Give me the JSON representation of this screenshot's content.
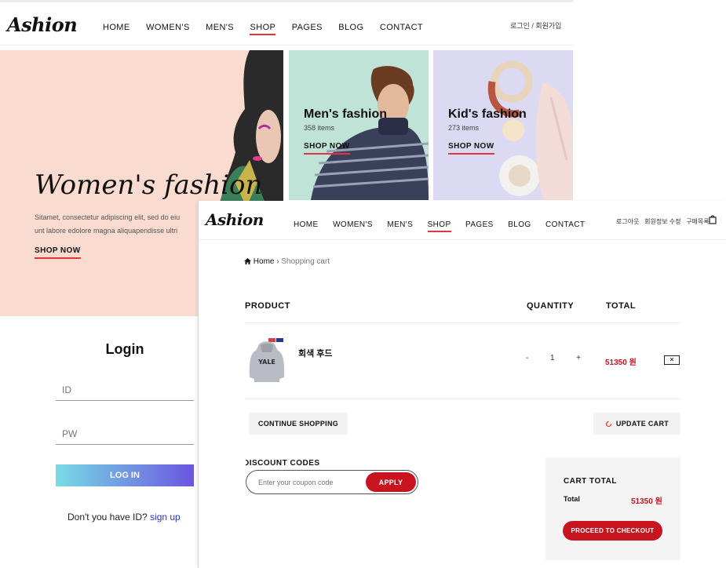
{
  "home": {
    "logo": "Ashion",
    "nav": [
      "HOME",
      "WOMEN'S",
      "MEN'S",
      "SHOP",
      "PAGES",
      "BLOG",
      "CONTACT"
    ],
    "active_nav": "SHOP",
    "auth_links": "로그인 / 회원가입",
    "hero": {
      "title": "Women's fashion",
      "text_line1": "Sitamet, consectetur adipiscing elit, sed do eiu",
      "text_line2": "unt labore edolore magna aliquapendisse ultri",
      "cta": "SHOP NOW"
    },
    "cards": [
      {
        "title": "Men's fashion",
        "count": "358 items",
        "cta": "SHOP NOW"
      },
      {
        "title": "Kid's fashion",
        "count": "273 items",
        "cta": "SHOP NOW"
      }
    ]
  },
  "login": {
    "title": "Login",
    "id_placeholder": "ID",
    "pw_placeholder": "PW",
    "button": "LOG IN",
    "signup_prompt": "Don't you have ID?",
    "signup_link": "sign up"
  },
  "cart_page": {
    "logo": "Ashion",
    "nav": [
      "HOME",
      "WOMEN'S",
      "MEN'S",
      "SHOP",
      "PAGES",
      "BLOG",
      "CONTACT"
    ],
    "active_nav": "SHOP",
    "user_links": [
      "로그아웃",
      "회원정보 수정",
      "구매목록"
    ],
    "breadcrumb": {
      "home": "Home",
      "separator": "›",
      "current": "Shopping cart"
    },
    "table_headers": {
      "product": "PRODUCT",
      "quantity": "QUANTITY",
      "total": "TOTAL"
    },
    "item": {
      "name": "회색 후드",
      "print": "YALE",
      "qty_minus": "-",
      "qty": "1",
      "qty_plus": "+",
      "total": "51350 원",
      "remove": "✕"
    },
    "continue_button": "CONTINUE SHOPPING",
    "update_button": "UPDATE CART",
    "discount": {
      "title": "DISCOUNT CODES",
      "placeholder": "Enter your coupon code",
      "apply": "APPLY"
    },
    "cart_total": {
      "title": "CART TOTAL",
      "label": "Total",
      "value": "51350 원",
      "checkout": "PROCEED TO CHECKOUT"
    }
  },
  "colors": {
    "accent": "#e53637",
    "button_red": "#c8141f",
    "hero_bg": "#f9dccf",
    "men_card_bg": "#bfe3d6",
    "kid_card_bg": "#dcd9f3",
    "login_gradient_start": "#78dbe6",
    "login_gradient_end": "#6b56e0",
    "link_blue": "#2a34c8"
  },
  "icons": {
    "breadcrumb_home": "home-icon",
    "cart": "shopping-bag-icon",
    "update": "refresh-icon",
    "remove": "close-icon"
  }
}
